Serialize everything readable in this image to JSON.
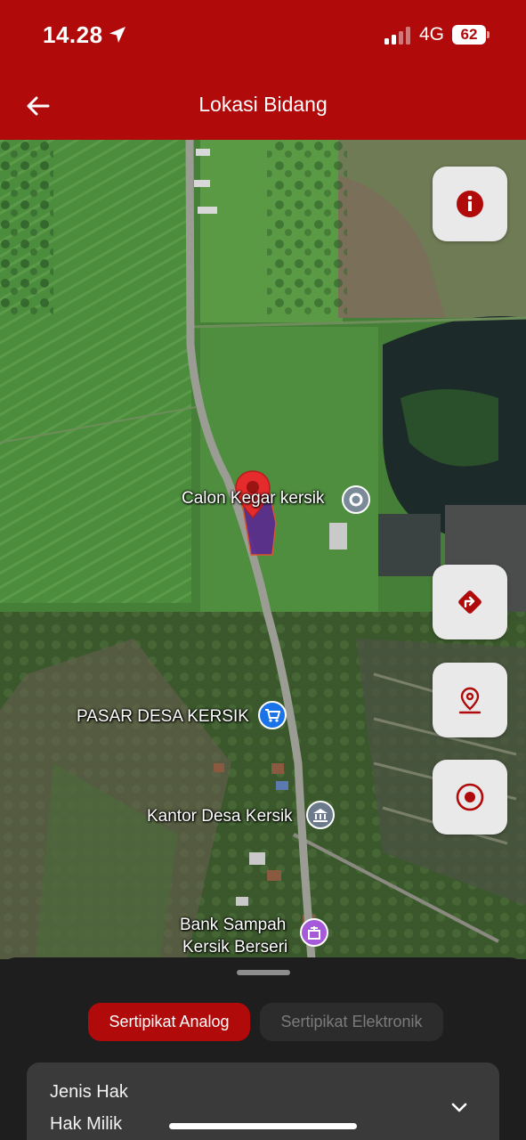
{
  "status_bar": {
    "time": "14.28",
    "network": "4G",
    "battery": "62"
  },
  "header": {
    "title": "Lokasi Bidang"
  },
  "map": {
    "labels": {
      "calon": "Calon Kegar kersik",
      "pasar": "PASAR DESA KERSIK",
      "kantor": "Kantor Desa Kersik",
      "bank_line1": "Bank Sampah",
      "bank_line2": "Kersik Berseri"
    },
    "parcel_color": "#5b2d8e",
    "pin_color": "#e52b2b"
  },
  "controls": {
    "info": "info-icon",
    "directions": "directions-icon",
    "location": "location-pin-icon",
    "target": "target-icon"
  },
  "sheet": {
    "tabs": [
      {
        "label": "Sertipikat Analog",
        "active": true
      },
      {
        "label": "Sertipikat Elektronik",
        "active": false
      }
    ],
    "field": {
      "label": "Jenis Hak",
      "value": "Hak Milik"
    }
  },
  "colors": {
    "brand": "#b00a0a",
    "sheet_bg": "#1e1e1e",
    "card_bg": "#3a3a3a"
  }
}
